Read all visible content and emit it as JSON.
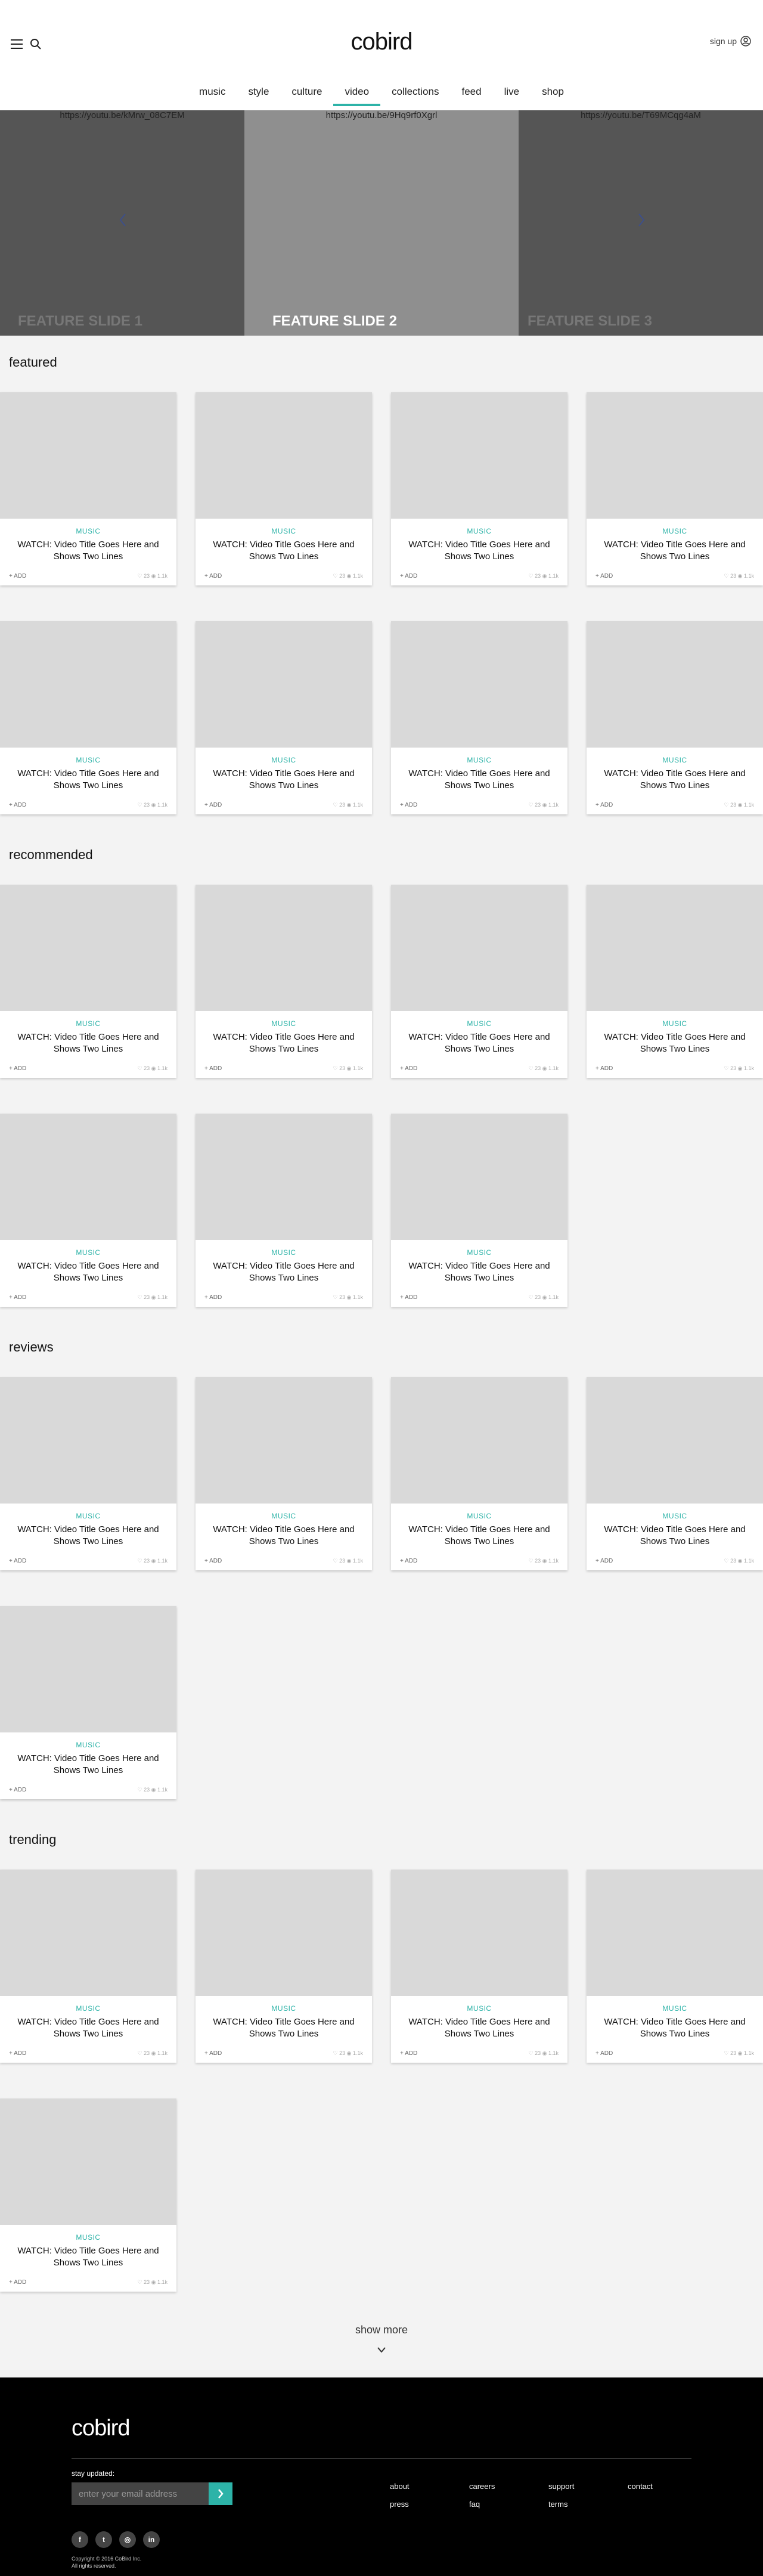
{
  "header": {
    "logo": "cobird",
    "signup_label": "sign up",
    "nav": [
      "music",
      "style",
      "culture",
      "video",
      "collections",
      "feed",
      "live",
      "shop"
    ],
    "active_nav": "video"
  },
  "carousel": {
    "slides": [
      {
        "url": "https://youtu.be/kMrw_08C7EM",
        "title": "FEATURE SLIDE 1"
      },
      {
        "url": "https://youtu.be/9Hq9rf0Xgrl",
        "title": "FEATURE SLIDE 2"
      },
      {
        "url": "https://youtu.be/T69MCqg4aM",
        "title": "FEATURE SLIDE 3"
      }
    ]
  },
  "card_template": {
    "category": "MUSIC",
    "title_line1": "WATCH: Video Title Goes Here and",
    "title_line2": "Shows Two Lines",
    "add_label": "+ ADD",
    "meta": "♡ 23 ◉ 1.1k"
  },
  "sections": [
    {
      "title": "featured",
      "cards": 8
    },
    {
      "title": "recommended",
      "cards": 7
    },
    {
      "title": "reviews",
      "cards": 5
    },
    {
      "title": "trending",
      "cards": 5
    }
  ],
  "show_more_label": "show more",
  "footer": {
    "logo": "cobird",
    "stay_label": "stay updated:",
    "email_placeholder": "enter your email address",
    "links": [
      "about",
      "careers",
      "support",
      "contact",
      "press",
      "faq",
      "terms"
    ],
    "social": [
      "facebook-icon",
      "twitter-icon",
      "instagram-icon",
      "linkedin-icon"
    ],
    "social_glyphs": [
      "f",
      "t",
      "◎",
      "in"
    ],
    "copyright_line1": "Copyright © 2016 CoBird Inc.",
    "copyright_line2": "All rights reserved."
  },
  "colors": {
    "accent": "#2db3a8",
    "footer_bg": "#000000",
    "page_bg": "#f3f3f3"
  }
}
